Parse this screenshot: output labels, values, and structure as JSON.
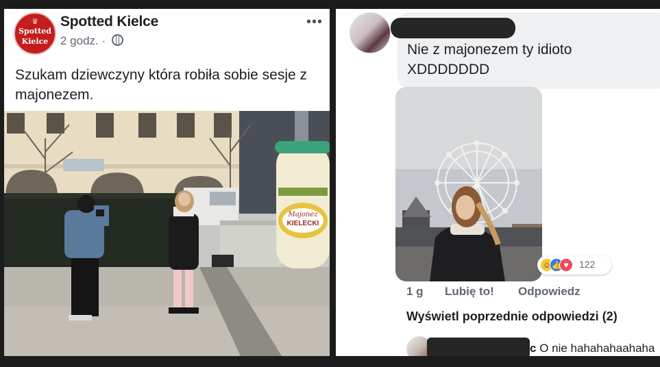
{
  "post": {
    "logo_lines": [
      "Spotted",
      "Kielce"
    ],
    "page_name": "Spotted Kielce",
    "time": "2 godz.",
    "separator": "·",
    "text": "Szukam dziewczyny która robiła sobie sesje z majonezem.",
    "sign_line1": "Majonez",
    "sign_line2": "KIELECKI"
  },
  "comment": {
    "text_line1": "Nie z majonezem ty idioto",
    "text_line2": "XDDDDDDD",
    "reactions": {
      "count": "122",
      "types": [
        "haha-icon",
        "like-icon",
        "love-icon"
      ]
    },
    "age": "1 g",
    "like_label": "Lubię to!",
    "reply_label": "Odpowiedz",
    "view_previous": "Wyświetl poprzednie odpowiedzi (2)",
    "sub_reply_suffix": "c",
    "sub_reply_text": "O nie hahahahaahaha"
  },
  "colors": {
    "background": "#1c1c1c",
    "logo_red": "#c41d1d",
    "bubble": "#eef0f2",
    "like_blue": "#2d79f4",
    "love_red": "#f04b5a",
    "haha_yellow": "#f7c73b"
  }
}
